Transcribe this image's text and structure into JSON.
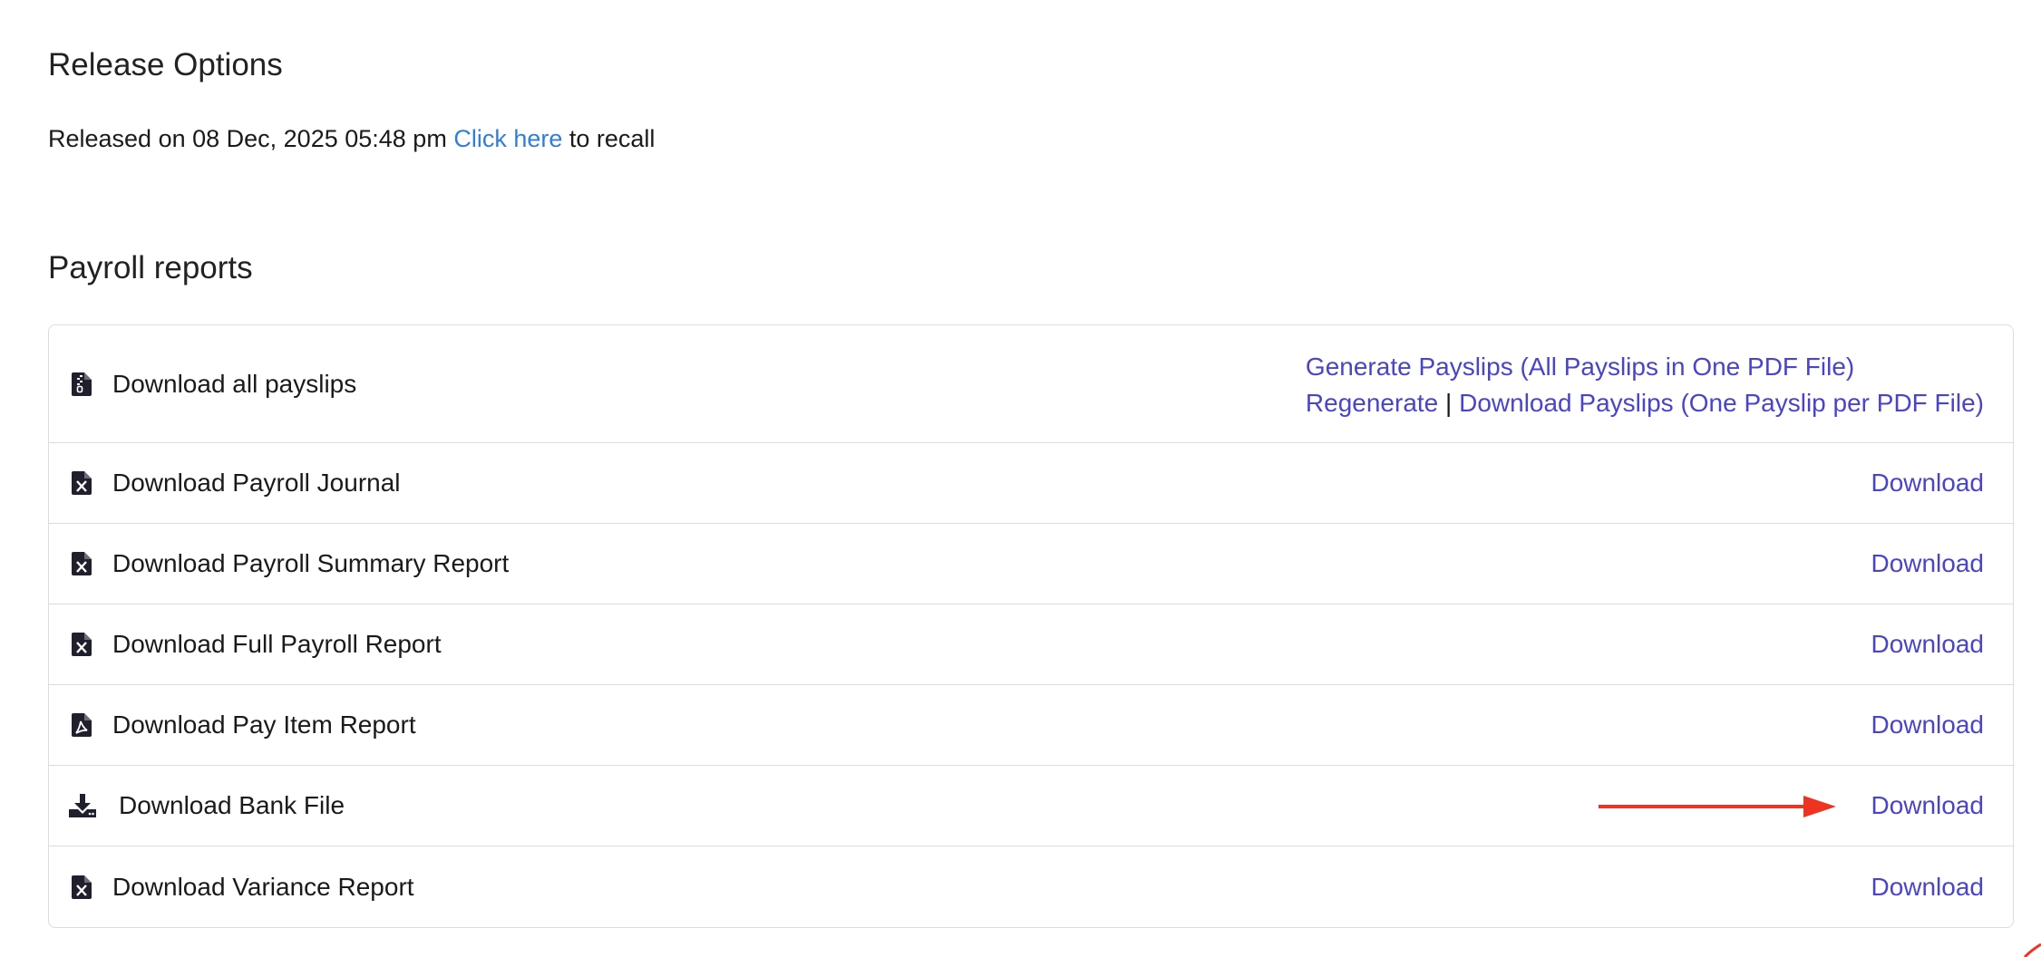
{
  "release": {
    "title": "Release Options",
    "released_prefix": "Released on 08 Dec, 2025 05:48 pm",
    "recall_link": "Click here",
    "recall_suffix": "to recall"
  },
  "reports": {
    "title": "Payroll reports",
    "payslips": {
      "label": "Download all payslips",
      "icon": "zip-file-icon",
      "generate_link": "Generate Payslips (All Payslips in One PDF File)",
      "regenerate_link": "Regenerate",
      "separator": "|",
      "download_each_link": "Download Payslips (One Payslip per PDF File)"
    },
    "rows": [
      {
        "label": "Download Payroll Journal",
        "icon": "excel-file-icon",
        "action": "Download"
      },
      {
        "label": "Download Payroll Summary Report",
        "icon": "excel-file-icon",
        "action": "Download"
      },
      {
        "label": "Download Full Payroll Report",
        "icon": "excel-file-icon",
        "action": "Download"
      },
      {
        "label": "Download Pay Item Report",
        "icon": "pdf-file-icon",
        "action": "Download"
      },
      {
        "label": "Download Bank File",
        "icon": "download-tray-icon",
        "action": "Download"
      },
      {
        "label": "Download Variance Report",
        "icon": "excel-file-icon",
        "action": "Download"
      }
    ]
  },
  "colors": {
    "link_blue": "#2f7ed8",
    "action_purple": "#4a44c8",
    "annotation_arrow": "#ee3322",
    "border": "#dcdcdc"
  }
}
